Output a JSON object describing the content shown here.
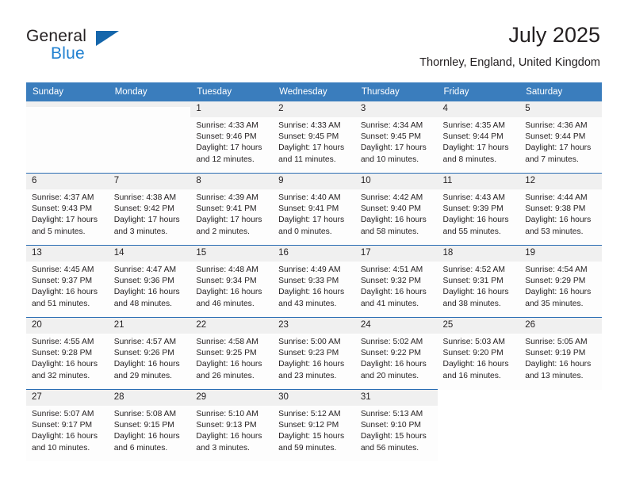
{
  "brand": {
    "name_dark": "General",
    "name_blue": "Blue",
    "triangle_color": "#1566ab",
    "blue_color": "#2080d0"
  },
  "header": {
    "title": "July 2025",
    "subtitle": "Thornley, England, United Kingdom"
  },
  "theme": {
    "header_bg": "#3a7dbd",
    "header_text": "#ffffff",
    "daynum_bg": "#f0f0f0",
    "row_divider": "#2a6db3",
    "body_text": "#231f20"
  },
  "calendar": {
    "weekday_headers": [
      "Sunday",
      "Monday",
      "Tuesday",
      "Wednesday",
      "Thursday",
      "Friday",
      "Saturday"
    ],
    "weeks": [
      [
        {
          "day": "",
          "lines": []
        },
        {
          "day": "",
          "lines": []
        },
        {
          "day": "1",
          "lines": [
            "Sunrise: 4:33 AM",
            "Sunset: 9:46 PM",
            "Daylight: 17 hours",
            "and 12 minutes."
          ]
        },
        {
          "day": "2",
          "lines": [
            "Sunrise: 4:33 AM",
            "Sunset: 9:45 PM",
            "Daylight: 17 hours",
            "and 11 minutes."
          ]
        },
        {
          "day": "3",
          "lines": [
            "Sunrise: 4:34 AM",
            "Sunset: 9:45 PM",
            "Daylight: 17 hours",
            "and 10 minutes."
          ]
        },
        {
          "day": "4",
          "lines": [
            "Sunrise: 4:35 AM",
            "Sunset: 9:44 PM",
            "Daylight: 17 hours",
            "and 8 minutes."
          ]
        },
        {
          "day": "5",
          "lines": [
            "Sunrise: 4:36 AM",
            "Sunset: 9:44 PM",
            "Daylight: 17 hours",
            "and 7 minutes."
          ]
        }
      ],
      [
        {
          "day": "6",
          "lines": [
            "Sunrise: 4:37 AM",
            "Sunset: 9:43 PM",
            "Daylight: 17 hours",
            "and 5 minutes."
          ]
        },
        {
          "day": "7",
          "lines": [
            "Sunrise: 4:38 AM",
            "Sunset: 9:42 PM",
            "Daylight: 17 hours",
            "and 3 minutes."
          ]
        },
        {
          "day": "8",
          "lines": [
            "Sunrise: 4:39 AM",
            "Sunset: 9:41 PM",
            "Daylight: 17 hours",
            "and 2 minutes."
          ]
        },
        {
          "day": "9",
          "lines": [
            "Sunrise: 4:40 AM",
            "Sunset: 9:41 PM",
            "Daylight: 17 hours",
            "and 0 minutes."
          ]
        },
        {
          "day": "10",
          "lines": [
            "Sunrise: 4:42 AM",
            "Sunset: 9:40 PM",
            "Daylight: 16 hours",
            "and 58 minutes."
          ]
        },
        {
          "day": "11",
          "lines": [
            "Sunrise: 4:43 AM",
            "Sunset: 9:39 PM",
            "Daylight: 16 hours",
            "and 55 minutes."
          ]
        },
        {
          "day": "12",
          "lines": [
            "Sunrise: 4:44 AM",
            "Sunset: 9:38 PM",
            "Daylight: 16 hours",
            "and 53 minutes."
          ]
        }
      ],
      [
        {
          "day": "13",
          "lines": [
            "Sunrise: 4:45 AM",
            "Sunset: 9:37 PM",
            "Daylight: 16 hours",
            "and 51 minutes."
          ]
        },
        {
          "day": "14",
          "lines": [
            "Sunrise: 4:47 AM",
            "Sunset: 9:36 PM",
            "Daylight: 16 hours",
            "and 48 minutes."
          ]
        },
        {
          "day": "15",
          "lines": [
            "Sunrise: 4:48 AM",
            "Sunset: 9:34 PM",
            "Daylight: 16 hours",
            "and 46 minutes."
          ]
        },
        {
          "day": "16",
          "lines": [
            "Sunrise: 4:49 AM",
            "Sunset: 9:33 PM",
            "Daylight: 16 hours",
            "and 43 minutes."
          ]
        },
        {
          "day": "17",
          "lines": [
            "Sunrise: 4:51 AM",
            "Sunset: 9:32 PM",
            "Daylight: 16 hours",
            "and 41 minutes."
          ]
        },
        {
          "day": "18",
          "lines": [
            "Sunrise: 4:52 AM",
            "Sunset: 9:31 PM",
            "Daylight: 16 hours",
            "and 38 minutes."
          ]
        },
        {
          "day": "19",
          "lines": [
            "Sunrise: 4:54 AM",
            "Sunset: 9:29 PM",
            "Daylight: 16 hours",
            "and 35 minutes."
          ]
        }
      ],
      [
        {
          "day": "20",
          "lines": [
            "Sunrise: 4:55 AM",
            "Sunset: 9:28 PM",
            "Daylight: 16 hours",
            "and 32 minutes."
          ]
        },
        {
          "day": "21",
          "lines": [
            "Sunrise: 4:57 AM",
            "Sunset: 9:26 PM",
            "Daylight: 16 hours",
            "and 29 minutes."
          ]
        },
        {
          "day": "22",
          "lines": [
            "Sunrise: 4:58 AM",
            "Sunset: 9:25 PM",
            "Daylight: 16 hours",
            "and 26 minutes."
          ]
        },
        {
          "day": "23",
          "lines": [
            "Sunrise: 5:00 AM",
            "Sunset: 9:23 PM",
            "Daylight: 16 hours",
            "and 23 minutes."
          ]
        },
        {
          "day": "24",
          "lines": [
            "Sunrise: 5:02 AM",
            "Sunset: 9:22 PM",
            "Daylight: 16 hours",
            "and 20 minutes."
          ]
        },
        {
          "day": "25",
          "lines": [
            "Sunrise: 5:03 AM",
            "Sunset: 9:20 PM",
            "Daylight: 16 hours",
            "and 16 minutes."
          ]
        },
        {
          "day": "26",
          "lines": [
            "Sunrise: 5:05 AM",
            "Sunset: 9:19 PM",
            "Daylight: 16 hours",
            "and 13 minutes."
          ]
        }
      ],
      [
        {
          "day": "27",
          "lines": [
            "Sunrise: 5:07 AM",
            "Sunset: 9:17 PM",
            "Daylight: 16 hours",
            "and 10 minutes."
          ]
        },
        {
          "day": "28",
          "lines": [
            "Sunrise: 5:08 AM",
            "Sunset: 9:15 PM",
            "Daylight: 16 hours",
            "and 6 minutes."
          ]
        },
        {
          "day": "29",
          "lines": [
            "Sunrise: 5:10 AM",
            "Sunset: 9:13 PM",
            "Daylight: 16 hours",
            "and 3 minutes."
          ]
        },
        {
          "day": "30",
          "lines": [
            "Sunrise: 5:12 AM",
            "Sunset: 9:12 PM",
            "Daylight: 15 hours",
            "and 59 minutes."
          ]
        },
        {
          "day": "31",
          "lines": [
            "Sunrise: 5:13 AM",
            "Sunset: 9:10 PM",
            "Daylight: 15 hours",
            "and 56 minutes."
          ]
        },
        {
          "day": "",
          "lines": []
        },
        {
          "day": "",
          "lines": []
        }
      ]
    ]
  }
}
